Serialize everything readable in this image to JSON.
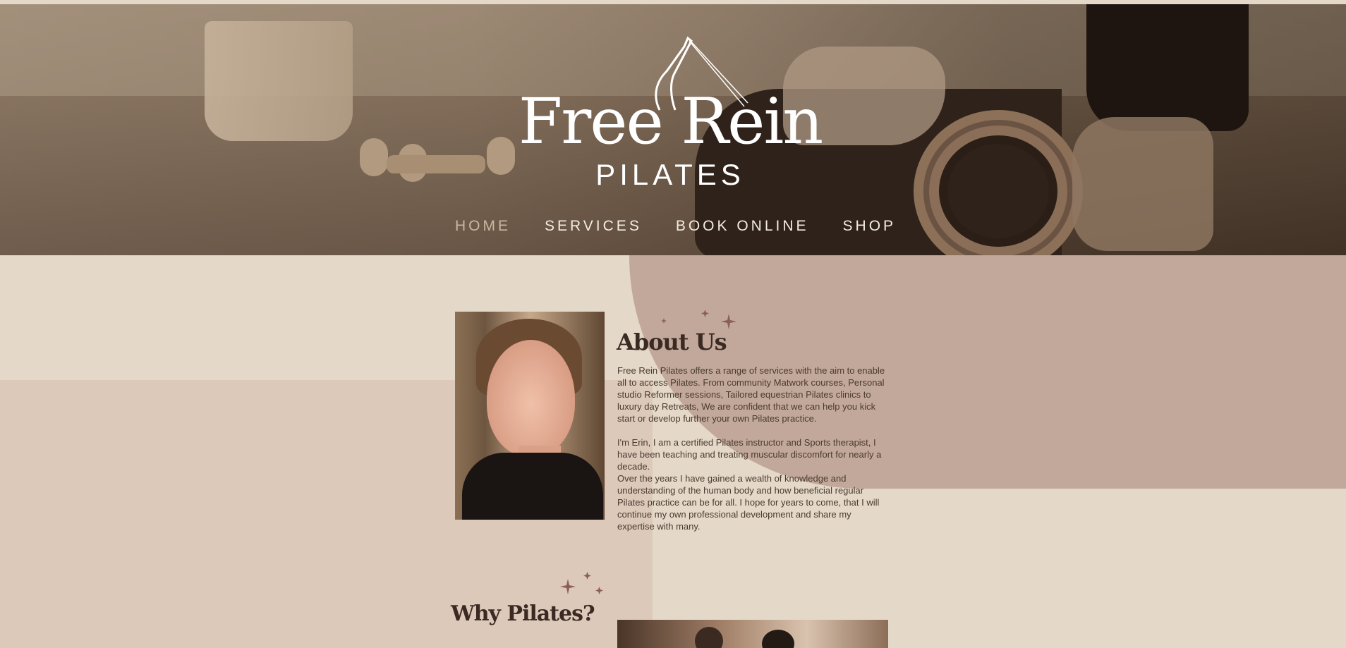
{
  "hero": {
    "brand_name": "Free Rein",
    "brand_sub": "PILATES"
  },
  "nav": {
    "items": [
      {
        "label": "HOME",
        "active": true
      },
      {
        "label": "SERVICES",
        "active": false
      },
      {
        "label": "BOOK ONLINE",
        "active": false
      },
      {
        "label": "SHOP",
        "active": false
      }
    ]
  },
  "about": {
    "title": "About Us",
    "paragraph_1": "Free Rein Pilates offers a range of services with the aim to enable all to access Pilates. From community Matwork courses, Personal studio Reformer sessions, Tailored equestrian Pilates clinics to luxury day Retreats, We are confident that we can help you kick start or develop further your own Pilates practice.",
    "paragraph_2": "I'm Erin, I am a certified Pilates instructor and Sports therapist, I have been teaching and treating muscular discomfort for nearly a decade.",
    "paragraph_3": "Over the years I have gained a wealth of knowledge and understanding of the human body and how beneficial regular Pilates practice can be for all. I hope for years to come, that I will continue my own professional development and share my expertise with many."
  },
  "why": {
    "title": "Why Pilates?"
  },
  "icons": {
    "sparkle": "sparkle-icon",
    "logo_figure": "pilates-figure-icon"
  },
  "colors": {
    "background": "#e4d8c8",
    "accent_shape": "#c2a89a",
    "sparkle": "#8b5e58",
    "heading": "#3b2a24"
  }
}
